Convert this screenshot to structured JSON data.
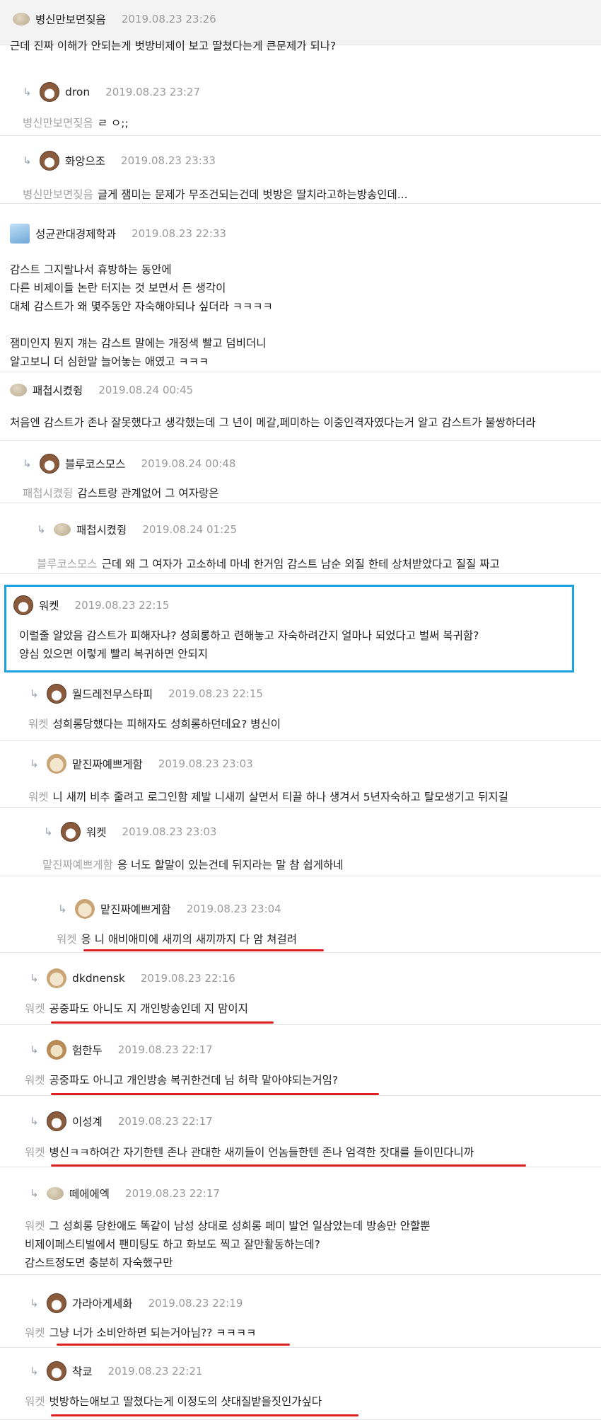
{
  "accent": {
    "highlight": "#1ba1dd",
    "underline": "#e02020"
  },
  "comments": [
    {
      "nick": "병신만보면짖음",
      "date": "2019.08.23 23:26",
      "icon": "beige-blob-avatar",
      "reply_to": "",
      "lines": [
        "근데 진짜 이해가 안되는게 벗방비제이 보고 딸쳤다는게 큰문제가 되나?"
      ]
    },
    {
      "nick": "dron",
      "date": "2019.08.23 23:27",
      "icon": "dog-avatar",
      "reply_to": "병신만보면짖음",
      "lines": [
        "ㄹ ㅇ;;"
      ]
    },
    {
      "nick": "화앙으조",
      "date": "2019.08.23 23:33",
      "icon": "puppy-avatar",
      "reply_to": "병신만보면짖음",
      "lines": [
        "글게 잼미는 문제가 무조건되는건데 벗방은 딸치라고하는방송인데..."
      ]
    },
    {
      "nick": "성균관대경제학과",
      "date": "2019.08.23 22:33",
      "icon": "blue-character-avatar",
      "reply_to": "",
      "lines": [
        "감스트 그지랄나서 휴방하는 동안에",
        "다른 비제이들 논란 터지는 것 보면서 든 생각이",
        "대체 감스트가 왜 몇주동안 자숙해야되나 싶더라 ㅋㅋㅋㅋ",
        "",
        "잼미인지 뭔지 걔는 감스트 말에는 개정색 빨고 덤비더니",
        "알고보니 더 심한말 늘어놓는 애였고 ㅋㅋㅋ"
      ]
    },
    {
      "nick": "패첩시켰쥥",
      "date": "2019.08.24 00:45",
      "icon": "beige-blob-avatar",
      "reply_to": "",
      "lines": [
        "처음엔 감스트가 존나 잘못했다고 생각했는데 그 년이 메갈,페미하는 이중인격자였다는거 알고 감스트가 불쌍하더라"
      ]
    },
    {
      "nick": "블루코스모스",
      "date": "2019.08.24 00:48",
      "icon": "dog-avatar",
      "reply_to": "패첩시켰쥥",
      "lines": [
        "감스트랑 관계없어 그 여자랑은"
      ]
    },
    {
      "nick": "패첩시켰쥥",
      "date": "2019.08.24 01:25",
      "icon": "beige-blob-avatar",
      "reply_to": "블루코스모스",
      "lines": [
        "근데 왜 그 여자가 고소하네 마네 한거임 감스트 남순 외질 한테 상처받았다고 질질 짜고"
      ]
    },
    {
      "nick": "워켓",
      "date": "2019.08.23 22:15",
      "icon": "dog-avatar",
      "reply_to": "",
      "lines": [
        "이럴줄 알았음 감스트가 피해자냐? 성희롱하고 련해놓고 자숙하려간지 얼마나 되었다고 벌써 복귀함?",
        "양심 있으면 이렇게 빨리 복귀하면 안되지"
      ]
    },
    {
      "nick": "월드레전무스타피",
      "date": "2019.08.23 22:15",
      "icon": "puppy-avatar",
      "reply_to": "워켓",
      "lines": [
        "성희롱당했다는 피해자도 성희롱하던데요? 병신이"
      ]
    },
    {
      "nick": "맡진짜예쁘게함",
      "date": "2019.08.23 23:03",
      "icon": "chihuahua-avatar",
      "reply_to": "워켓",
      "lines": [
        "니 새끼 비추 줄려고 로그인함 제발 니새끼 살면서 티끌 하나 생겨서 5년자숙하고 탈모생기고 뒤지길"
      ]
    },
    {
      "nick": "워켓",
      "date": "2019.08.23 23:03",
      "icon": "dog-avatar",
      "reply_to": "맡진짜예쁘게함",
      "lines": [
        "응 너도 할말이 있는건데 뒤지라는 말 참 쉽게하네"
      ]
    },
    {
      "nick": "맡진짜예쁘게함",
      "date": "2019.08.23 23:04",
      "icon": "chihuahua-avatar",
      "reply_to": "워켓",
      "lines": [
        "응 니 애비애미에 새끼의 새끼까지 다 암 쳐걸려"
      ]
    },
    {
      "nick": "dkdnensk",
      "date": "2019.08.23 22:16",
      "icon": "chihuahua-avatar",
      "reply_to": "워켓",
      "lines": [
        "공중파도 아니도 지 개인방송인데 지 맘이지"
      ]
    },
    {
      "nick": "험한두",
      "date": "2019.08.23 22:17",
      "icon": "pug-avatar",
      "reply_to": "워켓",
      "lines": [
        "공중파도 아니고 개인방송 복귀한건데 님 허락 맡아야되는거임?"
      ]
    },
    {
      "nick": "이성계",
      "date": "2019.08.23 22:17",
      "icon": "dog-avatar",
      "reply_to": "워켓",
      "lines": [
        "병신ㅋㅋ하여간 자기한텐 존나 관대한 새끼들이 언놈들한텐 존나 엄격한 잣대를 들이민다니까"
      ]
    },
    {
      "nick": "떼에에엑",
      "date": "2019.08.23 22:17",
      "icon": "beige-blob-avatar",
      "reply_to": "워켓",
      "lines": [
        "그 성희롱 당한애도 똑같이 남성 상대로 성희롱 페미 발언 일삼았는데 방송만 안할뿐",
        "비제이페스티벌에서 팬미팅도 하고 화보도 찍고 잘만활동하는데?",
        "감스트정도면 충분히 자숙했구만"
      ]
    },
    {
      "nick": "가라아게세화",
      "date": "2019.08.23 22:19",
      "icon": "dog-avatar",
      "reply_to": "워켓",
      "lines": [
        "그냥 너가 소비안하면 되는거아님?? ㅋㅋㅋㅋ"
      ]
    },
    {
      "nick": "착쿄",
      "date": "2019.08.23 22:21",
      "icon": "puppy-avatar",
      "reply_to": "워켓",
      "lines": [
        "벗방하는애보고 딸쳤다는게 이정도의 샷대질받을짓인가싶다"
      ]
    }
  ]
}
